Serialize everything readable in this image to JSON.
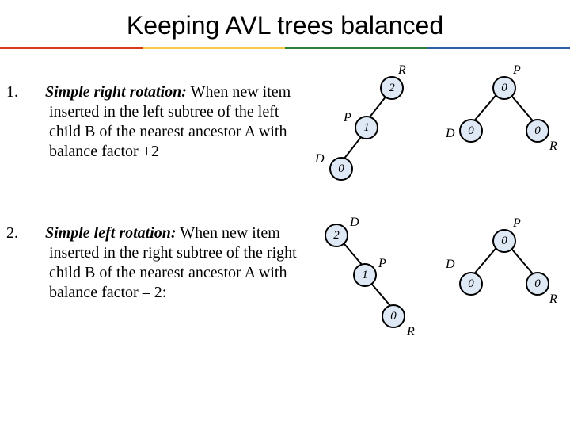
{
  "title": "Keeping AVL trees balanced",
  "items": [
    {
      "num": "1.",
      "bold": "Simple right rotation:",
      "rest": " When new item inserted in the left subtree of the left child B of the nearest ancestor A with balance factor +2"
    },
    {
      "num": "2.",
      "bold": "Simple left rotation:",
      "rest": " When new item inserted in the right subtree of the right child B of the nearest ancestor A with balance factor – 2:"
    }
  ],
  "diag1_left": {
    "labels": {
      "R": "R",
      "P": "P",
      "D": "D"
    },
    "nodes": {
      "a": "2",
      "b": "1",
      "c": "0"
    }
  },
  "diag1_right": {
    "labels": {
      "P": "P",
      "D": "D",
      "R": "R"
    },
    "nodes": {
      "a": "0",
      "b": "0",
      "c": "0"
    }
  },
  "diag2_left": {
    "labels": {
      "D": "D",
      "P": "P",
      "R": "R"
    },
    "nodes": {
      "a": "2",
      "b": "1",
      "c": "0"
    }
  },
  "diag2_right": {
    "labels": {
      "P": "P",
      "D": "D",
      "R": "R"
    },
    "nodes": {
      "a": "0",
      "b": "0",
      "c": "0"
    }
  },
  "chart_data": [
    {
      "type": "tree",
      "name": "right-rotation-before",
      "nodes": [
        {
          "id": "R",
          "balance": 2,
          "label": "R"
        },
        {
          "id": "P",
          "balance": 1,
          "label": "P",
          "parent": "R",
          "side": "left"
        },
        {
          "id": "D",
          "balance": 0,
          "label": "D",
          "parent": "P",
          "side": "left"
        }
      ]
    },
    {
      "type": "tree",
      "name": "right-rotation-after",
      "nodes": [
        {
          "id": "P",
          "balance": 0,
          "label": "P"
        },
        {
          "id": "D",
          "balance": 0,
          "label": "D",
          "parent": "P",
          "side": "left"
        },
        {
          "id": "R",
          "balance": 0,
          "label": "R",
          "parent": "P",
          "side": "right"
        }
      ]
    },
    {
      "type": "tree",
      "name": "left-rotation-before",
      "nodes": [
        {
          "id": "D",
          "balance": 2,
          "label": "D"
        },
        {
          "id": "P",
          "balance": 1,
          "label": "P",
          "parent": "D",
          "side": "right"
        },
        {
          "id": "R",
          "balance": 0,
          "label": "R",
          "parent": "P",
          "side": "right"
        }
      ]
    },
    {
      "type": "tree",
      "name": "left-rotation-after",
      "nodes": [
        {
          "id": "P",
          "balance": 0,
          "label": "P"
        },
        {
          "id": "D",
          "balance": 0,
          "label": "D",
          "parent": "P",
          "side": "left"
        },
        {
          "id": "R",
          "balance": 0,
          "label": "R",
          "parent": "P",
          "side": "right"
        }
      ]
    }
  ]
}
